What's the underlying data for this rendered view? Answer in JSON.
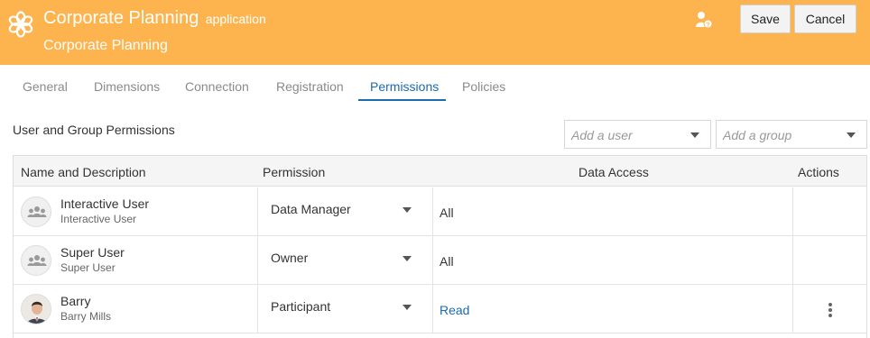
{
  "header": {
    "app_title": "Corporate Planning",
    "app_type": "application",
    "subtitle": "Corporate Planning",
    "icons": {
      "app": "flower-app-icon",
      "user_help": "user-help-icon"
    },
    "save_label": "Save",
    "cancel_label": "Cancel",
    "bg_color": "#fdb44f"
  },
  "tabs": [
    {
      "label": "General",
      "active": false
    },
    {
      "label": "Dimensions",
      "active": false
    },
    {
      "label": "Connection",
      "active": false
    },
    {
      "label": "Registration",
      "active": false
    },
    {
      "label": "Permissions",
      "active": true
    },
    {
      "label": "Policies",
      "active": false
    }
  ],
  "section": {
    "title": "User and Group Permissions",
    "add_user_placeholder": "Add a user",
    "add_group_placeholder": "Add a group"
  },
  "table": {
    "columns": [
      "Name and Description",
      "Permission",
      "Data Access",
      "Actions"
    ],
    "rows": [
      {
        "name": "Interactive User",
        "description": "Interactive User",
        "avatar": "group-avatar-icon",
        "permission": "Data Manager",
        "data_access": "All",
        "data_access_link": false,
        "has_actions": false
      },
      {
        "name": "Super User",
        "description": "Super User",
        "avatar": "group-avatar-icon",
        "permission": "Owner",
        "data_access": "All",
        "data_access_link": false,
        "has_actions": false
      },
      {
        "name": "Barry",
        "description": "Barry Mills",
        "avatar": "user-photo",
        "permission": "Participant",
        "data_access": "Read",
        "data_access_link": true,
        "has_actions": true
      }
    ]
  },
  "colors": {
    "accent": "#1a6bb0",
    "header": "#fdb44f"
  }
}
